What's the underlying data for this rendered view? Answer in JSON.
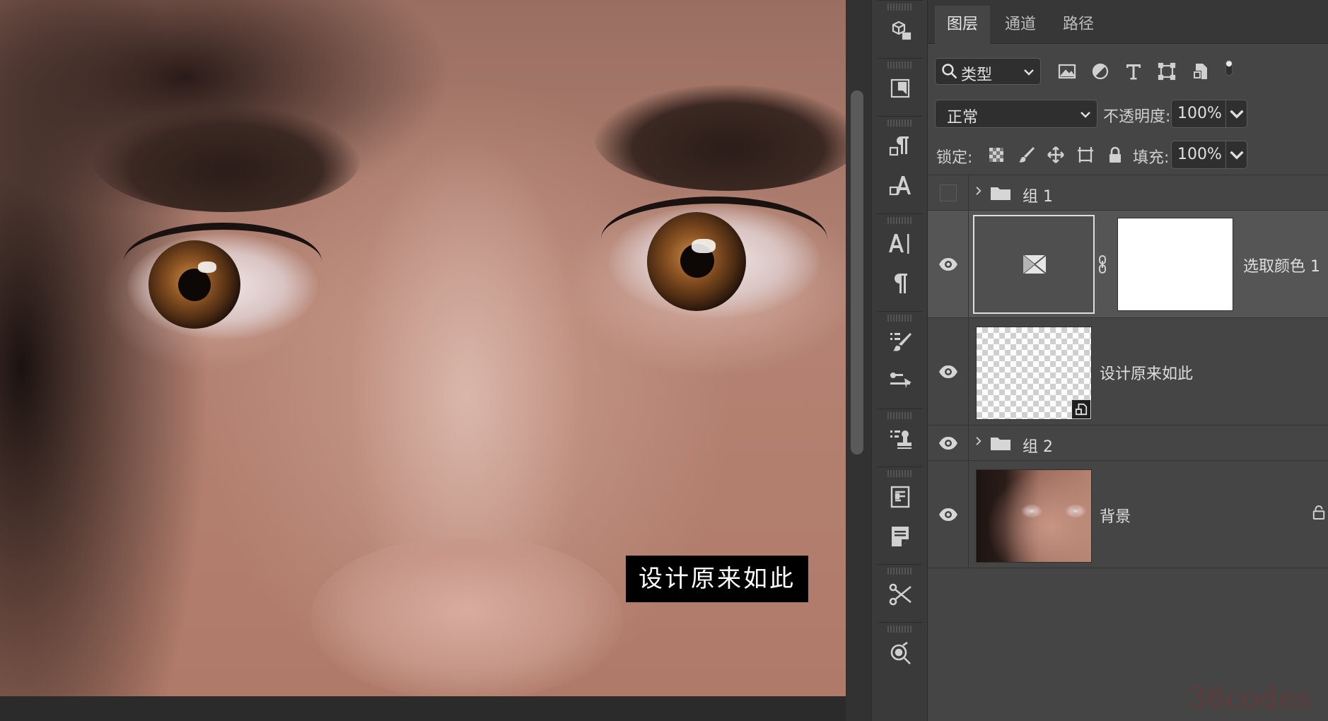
{
  "canvas": {
    "overlay_text": "设计原来如此"
  },
  "layers_panel": {
    "tabs": [
      {
        "label": "图层",
        "active": true
      },
      {
        "label": "通道",
        "active": false
      },
      {
        "label": "路径",
        "active": false
      }
    ],
    "filter": {
      "search_icon": "search-icon",
      "kind_label": "类型"
    },
    "blend_mode": "正常",
    "opacity_label": "不透明度:",
    "opacity_value": "100%",
    "lock_label": "锁定:",
    "fill_label": "填充:",
    "fill_value": "100%",
    "layers": [
      {
        "name": "组 1",
        "type": "group",
        "visible": false
      },
      {
        "name": "选取颜色 1",
        "type": "adjustment",
        "visible": true,
        "selected": true
      },
      {
        "name": "设计原来如此",
        "type": "smart-object",
        "visible": true
      },
      {
        "name": "组 2",
        "type": "group",
        "visible": true
      },
      {
        "name": "背景",
        "type": "pixel",
        "visible": true,
        "locked": true
      }
    ]
  },
  "watermark": "38codes",
  "colors": {
    "panel_bg": "#454545",
    "selected_row": "#555555",
    "toolstrip_bg": "#3a3a3a",
    "overlay_bg": "#000000"
  }
}
